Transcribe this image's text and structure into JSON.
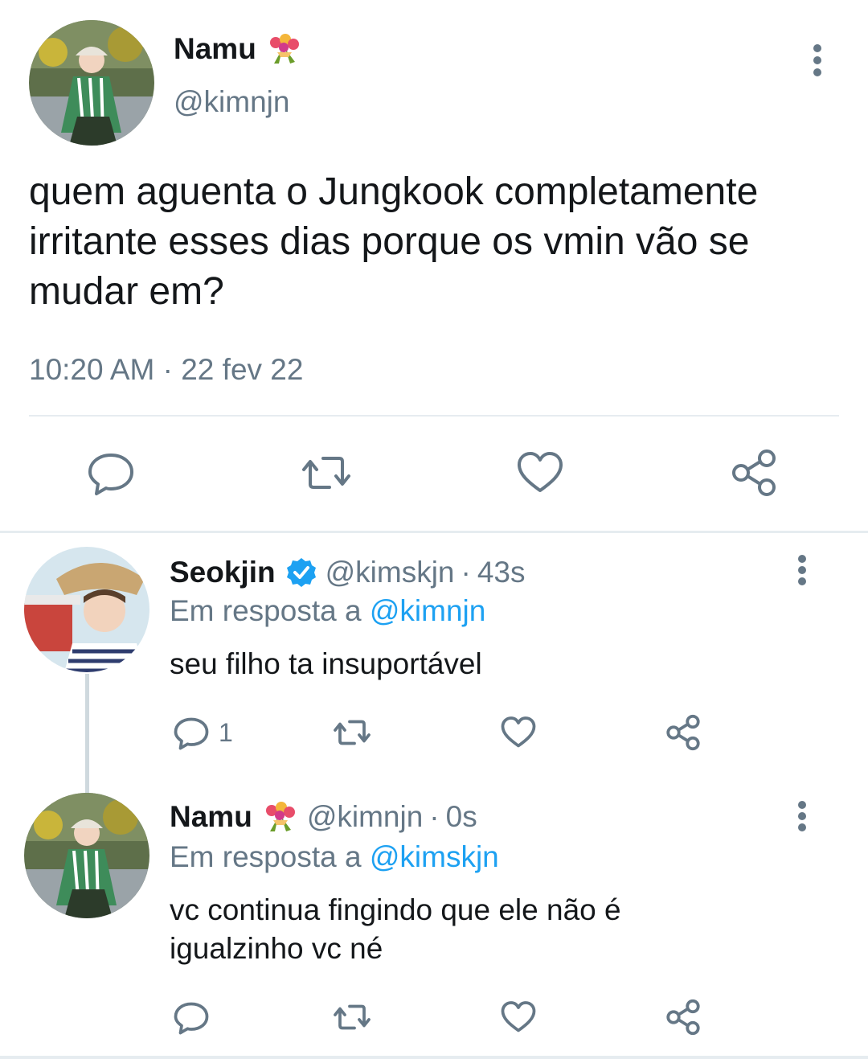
{
  "main_tweet": {
    "author_name": "Namu",
    "emoji_icon": "bouquet-icon",
    "handle": "@kimnjn",
    "text": "quem aguenta o Jungkook completamente irritante esses dias porque os vmin vão se mudar em?",
    "time": "10:20 AM",
    "separator": "·",
    "date": "22 fev 22",
    "actions": [
      "reply-icon",
      "retweet-icon",
      "like-icon",
      "share-icon"
    ]
  },
  "replies": [
    {
      "author_name": "Seokjin",
      "verified_icon": "verified-badge-icon",
      "handle": "@kimskjn",
      "separator": "·",
      "time": "43s",
      "reply_prefix": "Em resposta a",
      "reply_to": "@kimnjn",
      "text": "seu filho ta insuportável",
      "reply_count": "1"
    },
    {
      "author_name": "Namu",
      "emoji_icon": "bouquet-icon",
      "handle": "@kimnjn",
      "separator": "·",
      "time": "0s",
      "reply_prefix": "Em resposta a",
      "reply_to": "@kimskjn",
      "text": "vc continua fingindo que ele não é igualzinho vc né",
      "reply_count": ""
    }
  ],
  "colors": {
    "accent": "#1da1f2",
    "muted": "#657786",
    "text": "#14171a",
    "divider": "#e6ecf0"
  }
}
